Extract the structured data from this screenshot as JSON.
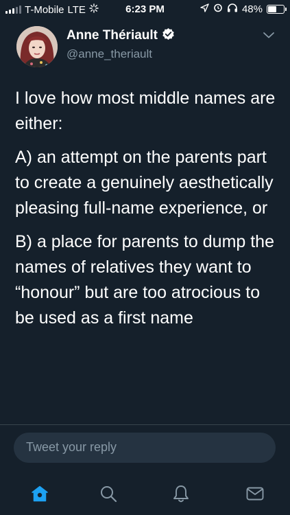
{
  "status_bar": {
    "carrier": "T-Mobile",
    "network": "LTE",
    "time": "6:23 PM",
    "battery": "48%",
    "battery_level": 0.48
  },
  "tweet": {
    "author_name": "Anne Thériault",
    "author_handle": "@anne_theriault",
    "verified": true,
    "paragraphs": [
      "I love how most middle names are either:",
      "A) an attempt on the parents part to create a genuinely aesthetically pleasing full-name experience, or",
      "B) a place for parents to dump the names of relatives they want to “honour” but are too atrocious to be used as a first name"
    ]
  },
  "reply": {
    "placeholder": "Tweet your reply"
  },
  "tab_bar": {
    "items": [
      {
        "name": "home",
        "icon": "home-icon",
        "active": true
      },
      {
        "name": "search",
        "icon": "search-icon",
        "active": false
      },
      {
        "name": "notifications",
        "icon": "bell-icon",
        "active": false
      },
      {
        "name": "messages",
        "icon": "mail-icon",
        "active": false
      }
    ]
  },
  "colors": {
    "background": "#15202b",
    "accent": "#1da1f2",
    "secondary_text": "#8899a6",
    "reply_box": "#253341"
  }
}
